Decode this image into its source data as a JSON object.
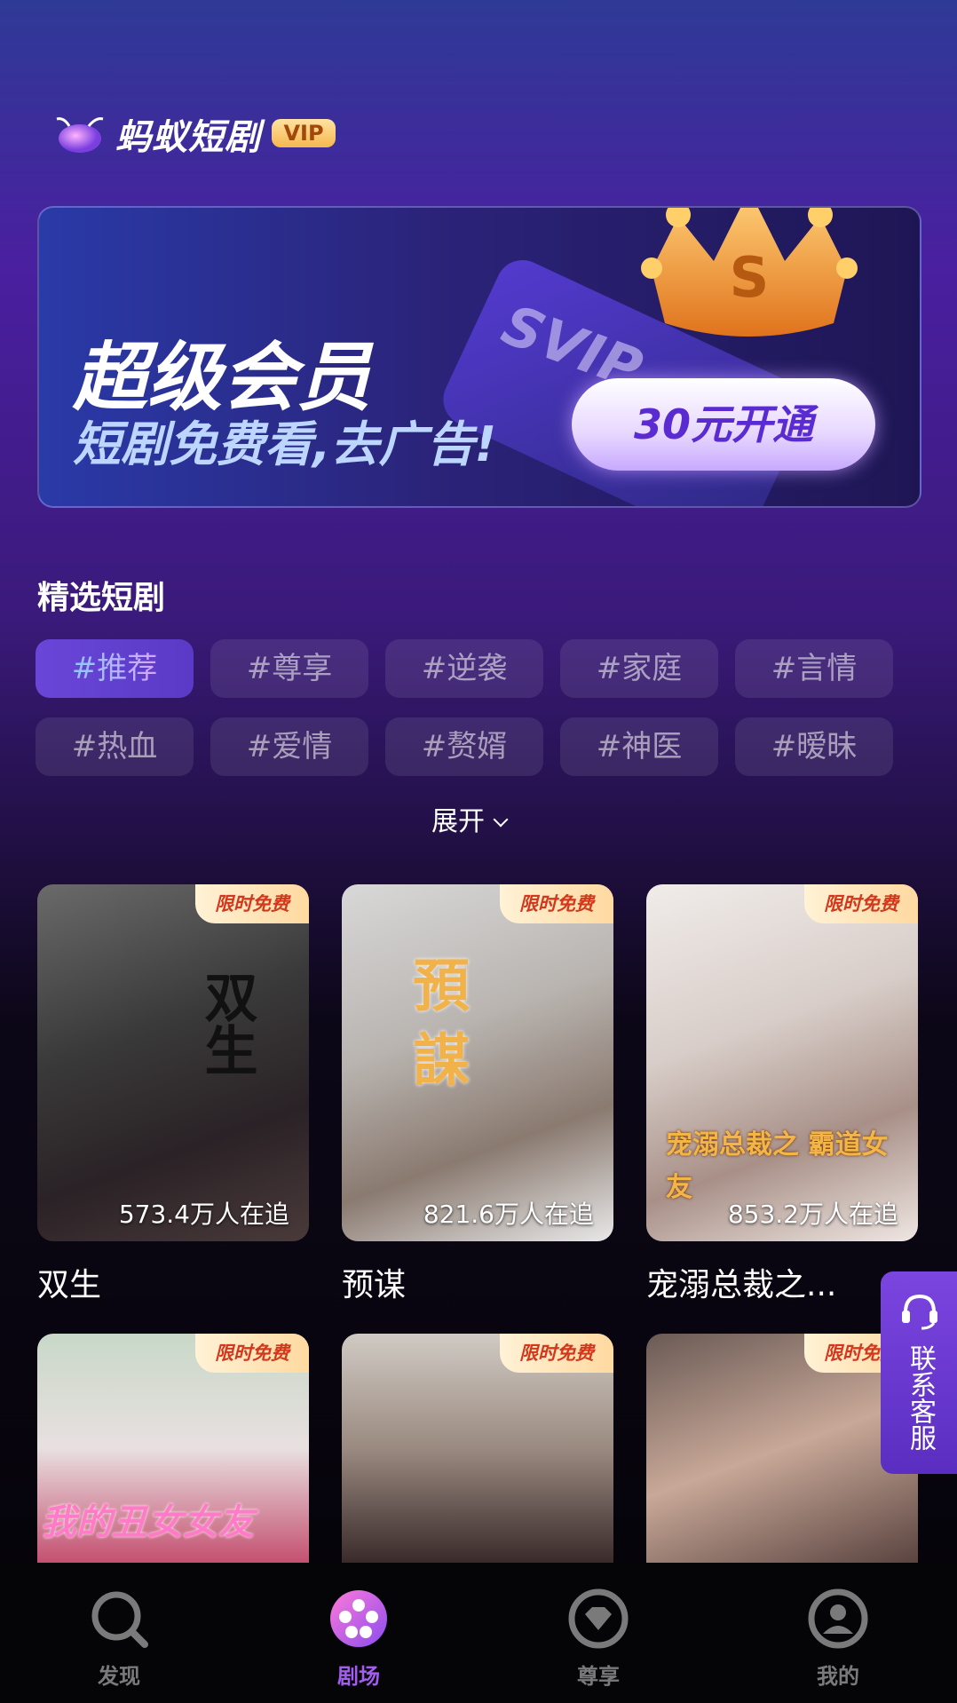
{
  "header": {
    "app_name": "蚂蚁短剧",
    "vip_badge": "VIP"
  },
  "banner": {
    "title": "超级会员",
    "subtitle": "短剧免费看,去广告!",
    "card_text": "SVIP",
    "crown_letter": "S",
    "button": "30元开通"
  },
  "section": {
    "title": "精选短剧",
    "tags": [
      "#推荐",
      "#尊享",
      "#逆袭",
      "#家庭",
      "#言情",
      "#热血",
      "#爱情",
      "#赘婿",
      "#神医",
      "#暧昧"
    ],
    "active_tag_index": 0,
    "expand_label": "展开"
  },
  "dramas": [
    {
      "title": "双生",
      "followers": "573.4万人在追",
      "badge": "限时免费",
      "poster_text": "双生"
    },
    {
      "title": "预谋",
      "followers": "821.6万人在追",
      "badge": "限时免费",
      "poster_text": "預謀"
    },
    {
      "title": "宠溺总裁之...",
      "followers": "853.2万人在追",
      "badge": "限时免费",
      "poster_text": "宠溺总裁之 霸道女友"
    },
    {
      "title": "",
      "followers": "",
      "badge": "限时免费",
      "poster_text": "我的丑女女友"
    },
    {
      "title": "",
      "followers": "",
      "badge": "限时免费",
      "poster_text": ""
    },
    {
      "title": "",
      "followers": "",
      "badge": "限时免费",
      "poster_text": ""
    }
  ],
  "customer_service": {
    "label": "联系客服"
  },
  "nav": [
    {
      "label": "发现",
      "icon": "search-icon"
    },
    {
      "label": "剧场",
      "icon": "film-reel-icon",
      "active": true
    },
    {
      "label": "尊享",
      "icon": "diamond-icon"
    },
    {
      "label": "我的",
      "icon": "user-icon"
    }
  ],
  "colors": {
    "accent": "#a35df0",
    "free_badge_text": "#d3381c"
  }
}
